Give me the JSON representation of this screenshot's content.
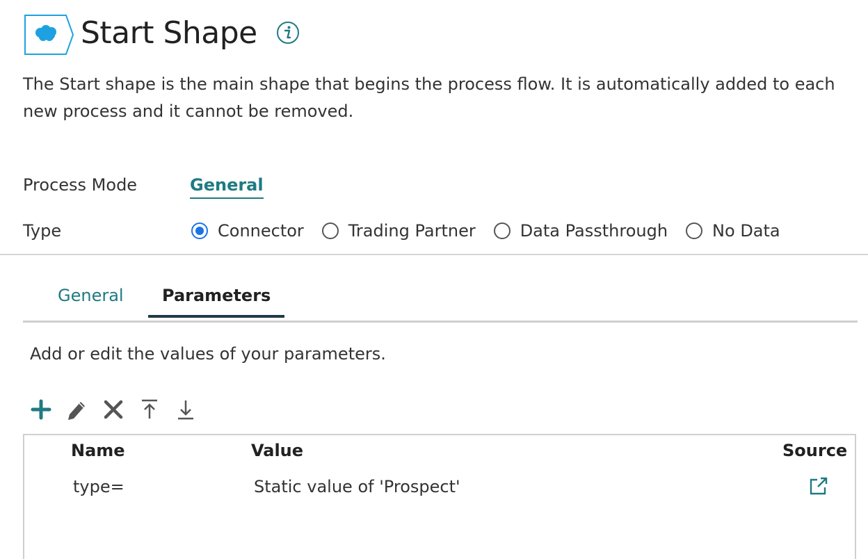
{
  "header": {
    "icon": "salesforce-cloud-icon",
    "title": "Start Shape",
    "info_icon": "info-icon",
    "description": "The Start shape is the main shape that begins the process flow. It is automatically added to each new process and it cannot be removed."
  },
  "form": {
    "process_mode_label": "Process Mode",
    "process_mode_value": "General",
    "type_label": "Type",
    "type_options": [
      {
        "label": "Connector",
        "selected": true
      },
      {
        "label": "Trading Partner",
        "selected": false
      },
      {
        "label": "Data Passthrough",
        "selected": false
      },
      {
        "label": "No Data",
        "selected": false
      }
    ]
  },
  "tabs": [
    {
      "label": "General",
      "active": false
    },
    {
      "label": "Parameters",
      "active": true
    }
  ],
  "parameters": {
    "hint": "Add or edit the values of your parameters.",
    "toolbar": [
      "add-icon",
      "edit-pencil-icon",
      "delete-x-icon",
      "move-to-top-icon",
      "move-to-bottom-icon"
    ],
    "columns": {
      "name": "Name",
      "value": "Value",
      "source": "Source"
    },
    "rows": [
      {
        "name": "type=",
        "value": "Static value of 'Prospect'",
        "source_icon": "external-link-icon"
      }
    ]
  },
  "colors": {
    "accent_teal": "#1f7a82",
    "radio_blue": "#1a73e8",
    "salesforce_blue": "#1ea1e0",
    "tab_underline": "#1f3b47"
  }
}
